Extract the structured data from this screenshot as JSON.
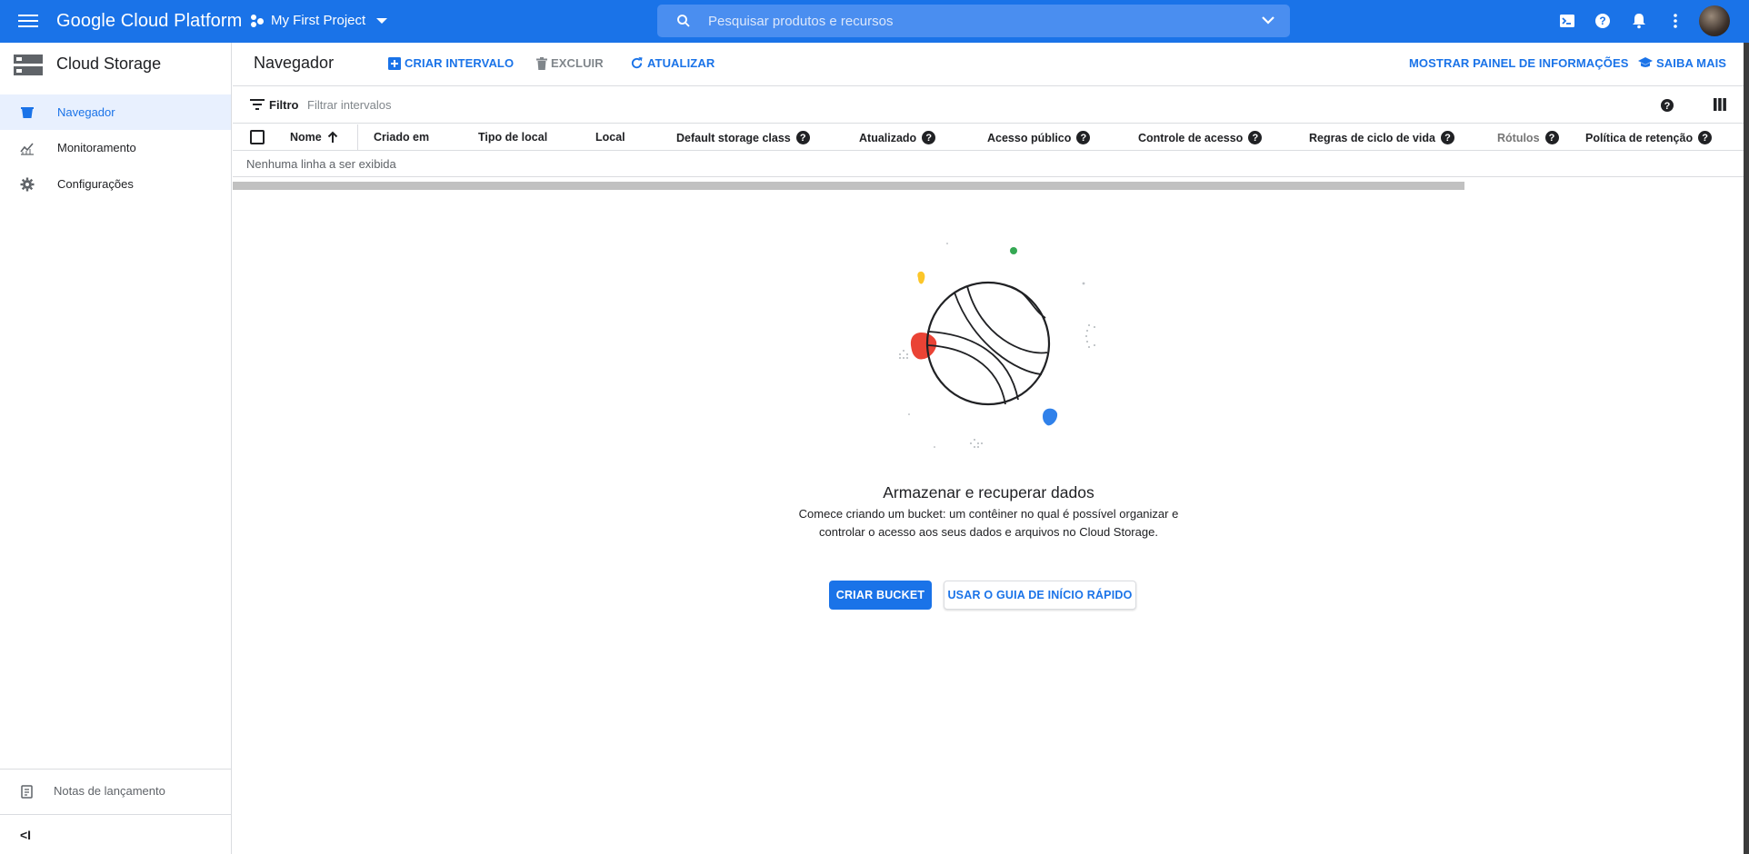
{
  "topbar": {
    "brand": "Google Cloud Platform",
    "project": "My First Project",
    "search_placeholder": "Pesquisar produtos e recursos",
    "accent": "#1a73e8"
  },
  "sidebar": {
    "title": "Cloud Storage",
    "items": [
      {
        "label": "Navegador",
        "icon": "bucket-icon",
        "active": true
      },
      {
        "label": "Monitoramento",
        "icon": "chart-icon",
        "active": false
      },
      {
        "label": "Configurações",
        "icon": "gear-icon",
        "active": false
      }
    ],
    "release_notes": "Notas de lançamento",
    "collapse_glyph": "<I"
  },
  "header": {
    "page_title": "Navegador",
    "create_bucket": "CRIAR INTERVALO",
    "delete": "EXCLUIR",
    "refresh": "ATUALIZAR",
    "info_panel": "MOSTRAR PAINEL DE INFORMAÇÕES",
    "learn_more": "SAIBA MAIS"
  },
  "filter": {
    "label": "Filtro",
    "placeholder": "Filtrar intervalos"
  },
  "table": {
    "columns": [
      "Nome",
      "Criado em",
      "Tipo de local",
      "Local",
      "Default storage class",
      "Atualizado",
      "Acesso público",
      "Controle de acesso",
      "Regras de ciclo de vida",
      "Rótulos",
      "Política de retenção"
    ],
    "empty_text": "Nenhuma linha a ser exibida"
  },
  "empty_state": {
    "title": "Armazenar e recuperar dados",
    "description": "Comece criando um bucket: um contêiner no qual é possível organizar e controlar o acesso aos seus dados e arquivos no Cloud Storage.",
    "primary_button": "CRIAR BUCKET",
    "secondary_button": "USAR O GUIA DE INÍCIO RÁPIDO"
  }
}
